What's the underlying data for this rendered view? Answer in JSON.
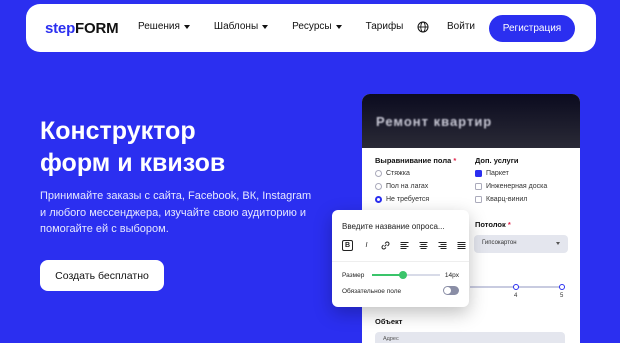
{
  "nav": {
    "logo_part1": "step",
    "logo_part2": "FORM",
    "menu": [
      {
        "label": "Решения",
        "dropdown": true
      },
      {
        "label": "Шаблоны",
        "dropdown": true
      },
      {
        "label": "Ресурсы",
        "dropdown": true
      },
      {
        "label": "Тарифы",
        "dropdown": false
      }
    ],
    "globe_icon": "globe-icon",
    "login": "Войти",
    "signup": "Регистрация"
  },
  "hero": {
    "title_line1": "Конструктор",
    "title_line2": "форм и квизов",
    "description": "Принимайте заказы с сайта, Facebook, ВК, Instagram и любого мессенджера, изучайте свою аудиторию и помогайте ей с выбором.",
    "cta": "Создать бесплатно"
  },
  "form_card": {
    "title": "Ремонт квартир",
    "alignment": {
      "label": "Выравнивание пола",
      "required_mark": "*",
      "options": [
        "Стяжка",
        "Пол на лагах",
        "Не требуется"
      ],
      "selected": 2
    },
    "extras": {
      "label": "Доп. услуги",
      "options": [
        "Паркет",
        "Инженерная доска",
        "Кварц-винил"
      ],
      "checked": [
        0
      ]
    },
    "ceiling": {
      "label": "Потолок",
      "required_mark": "*",
      "value": "Гипсокартон"
    },
    "scale_ticks": [
      "4",
      "5"
    ],
    "object": {
      "label": "Объект",
      "placeholder": "Адрес"
    }
  },
  "editor": {
    "input_placeholder": "Введите название опроса...",
    "toolbar": [
      "B",
      "I",
      "link-icon",
      "align-left-icon",
      "align-center-icon",
      "align-right-icon",
      "align-justify-icon"
    ],
    "size_label": "Размер",
    "size_value": "14px",
    "size_fraction": 0.45,
    "required_label": "Обязательное поле",
    "required_on": false
  },
  "colors": {
    "brand": "#2b2ff0",
    "slider": "#3ac46a"
  }
}
